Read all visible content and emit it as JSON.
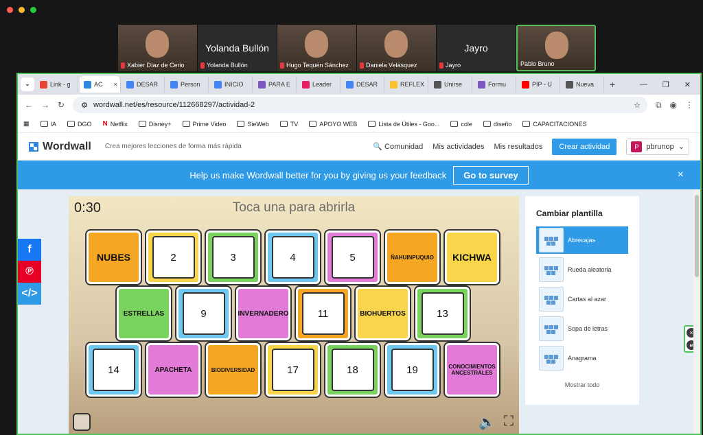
{
  "traffic_lights": [
    "#ff5f57",
    "#febc2e",
    "#28c840"
  ],
  "participants": [
    {
      "name": "Xabier Díaz de Cerio",
      "muted": true,
      "video": true
    },
    {
      "name": "Yolanda Bullón",
      "big_label": "Yolanda Bullón",
      "muted": true,
      "video": false
    },
    {
      "name": "Hugo Tequén Sánchez",
      "muted": true,
      "video": true
    },
    {
      "name": "Daniela Velásquez",
      "muted": true,
      "video": true
    },
    {
      "name": "Jayro",
      "big_label": "Jayro",
      "muted": true,
      "video": false
    },
    {
      "name": "Pablo Bruno",
      "muted": false,
      "video": true,
      "active": true
    }
  ],
  "tabs": [
    {
      "label": "Link - g",
      "color": "#ea4335"
    },
    {
      "label": "AC",
      "color": "#2f88e0",
      "active": true,
      "close": "×"
    },
    {
      "label": "DESAR",
      "color": "#4285f4"
    },
    {
      "label": "Person",
      "color": "#4285f4"
    },
    {
      "label": "INICIO",
      "color": "#4285f4"
    },
    {
      "label": "PARA E",
      "color": "#7e57c2"
    },
    {
      "label": "Leader",
      "color": "#e91e63"
    },
    {
      "label": "DESAR",
      "color": "#4285f4"
    },
    {
      "label": "REFLEX",
      "color": "#fbc02d"
    },
    {
      "label": "Unirse",
      "color": "#555555"
    },
    {
      "label": "Formu",
      "color": "#7e57c2"
    },
    {
      "label": "PIP - U",
      "color": "#ff0000"
    },
    {
      "label": "Nueva",
      "color": "#555555"
    }
  ],
  "address": {
    "url": "wordwall.net/es/resource/112668297/actividad-2"
  },
  "bookmarks": [
    {
      "label": "IA"
    },
    {
      "label": "DGO"
    },
    {
      "label": "Netflix"
    },
    {
      "label": "Disney+"
    },
    {
      "label": "Prime Video"
    },
    {
      "label": "SieWeb"
    },
    {
      "label": "TV"
    },
    {
      "label": "APOYO WEB"
    },
    {
      "label": "Lista de Útiles - Goo..."
    },
    {
      "label": "cole"
    },
    {
      "label": "diseño"
    },
    {
      "label": "CAPACITACIONES"
    }
  ],
  "wordwall": {
    "logo": "Wordwall",
    "tagline": "Crea mejores lecciones de forma más rápida",
    "nav": {
      "community": "Comunidad",
      "activities": "Mis actividades",
      "results": "Mis resultados",
      "create": "Crear actividad"
    },
    "user": {
      "initial": "P",
      "name": "pbrunop"
    }
  },
  "feedback": {
    "text": "Help us make Wordwall better for you by giving us your feedback",
    "button": "Go to survey",
    "close": "×"
  },
  "game": {
    "timer": "0:30",
    "instruction": "Toca una para abrirla",
    "cards": [
      {
        "label": "NUBES",
        "color": "#f5a623",
        "open": true
      },
      {
        "label": "2",
        "color": "#f8d54a",
        "open": false
      },
      {
        "label": "3",
        "color": "#7bd35f",
        "open": false
      },
      {
        "label": "4",
        "color": "#6fc8ef",
        "open": false
      },
      {
        "label": "5",
        "color": "#e27ad8",
        "open": false
      },
      {
        "label": "ÑAHUINPUQUIO",
        "color": "#f5a623",
        "open": true
      },
      {
        "label": "KICHWA",
        "color": "#f8d54a",
        "open": true
      },
      {
        "label": "ESTRELLAS",
        "color": "#7bd35f",
        "open": true
      },
      {
        "label": "9",
        "color": "#6fc8ef",
        "open": false
      },
      {
        "label": "INVERNADERO",
        "color": "#e27ad8",
        "open": true
      },
      {
        "label": "11",
        "color": "#f5a623",
        "open": false
      },
      {
        "label": "BIOHUERTOS",
        "color": "#f8d54a",
        "open": true
      },
      {
        "label": "13",
        "color": "#7bd35f",
        "open": false
      },
      {
        "label": "14",
        "color": "#6fc8ef",
        "open": false
      },
      {
        "label": "APACHETA",
        "color": "#e27ad8",
        "open": true
      },
      {
        "label": "BIODIVERSIDAD",
        "color": "#f5a623",
        "open": true
      },
      {
        "label": "17",
        "color": "#f8d54a",
        "open": false
      },
      {
        "label": "18",
        "color": "#7bd35f",
        "open": false
      },
      {
        "label": "19",
        "color": "#6fc8ef",
        "open": false
      },
      {
        "label": "CONOCIMIENTOS ANCESTRALES",
        "color": "#e27ad8",
        "open": true
      }
    ]
  },
  "template_panel": {
    "title": "Cambiar plantilla",
    "options": [
      {
        "label": "Abrecajas",
        "selected": true
      },
      {
        "label": "Rueda aleatoria"
      },
      {
        "label": "Cartas al azar"
      },
      {
        "label": "Sopa de letras"
      },
      {
        "label": "Anagrama"
      }
    ],
    "show_all": "Mostrar todo"
  },
  "social": [
    {
      "icon": "facebook-icon",
      "glyph": "f",
      "color": "#1877f2"
    },
    {
      "icon": "pinterest-icon",
      "glyph": "℗",
      "color": "#e60023"
    },
    {
      "icon": "embed-icon",
      "glyph": "</>",
      "color": "#2f9ae6"
    }
  ]
}
